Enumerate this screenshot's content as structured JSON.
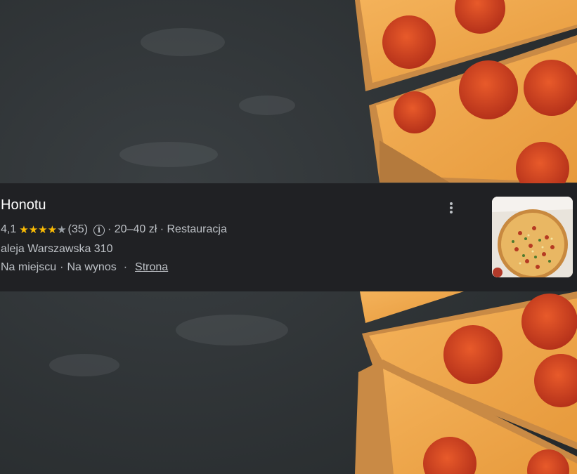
{
  "place": {
    "name": "Honotu",
    "rating": "4,1",
    "reviews": "(35)",
    "price": "20–40 zł",
    "category": "Restauracja",
    "address": "aleja Warszawska 310",
    "service_1": "Na miejscu",
    "service_2": "Na wynos",
    "website_link": "Strona",
    "rating_stars": 4,
    "star_color": "#fbbc04",
    "empty_star_color": "#9aa0a6"
  },
  "icons": {
    "info": "info-icon",
    "menu": "more-vert-icon"
  }
}
